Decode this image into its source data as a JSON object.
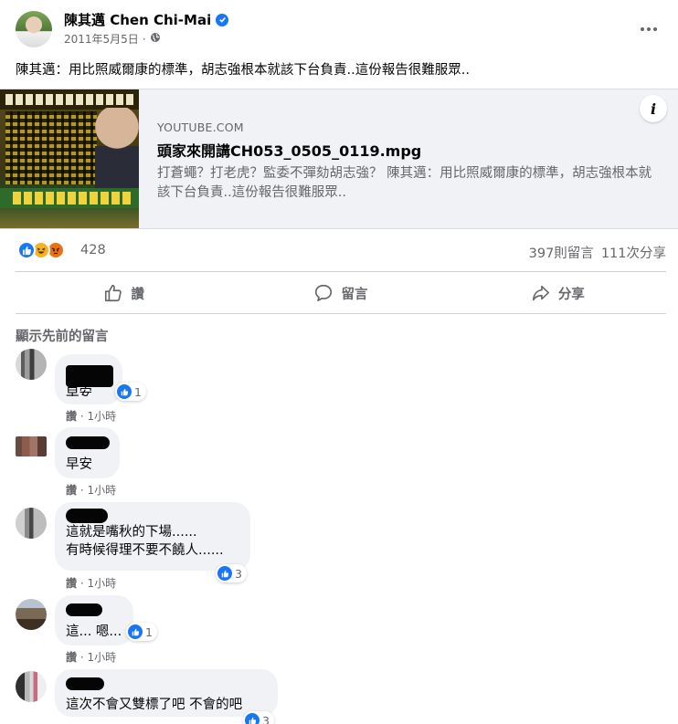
{
  "post": {
    "author_name": "陳其邁 Chen Chi-Mai",
    "date": "2011年5月5日",
    "dot": "·",
    "text": "陳其邁：用比照威爾康的標準，胡志強根本就該下台負責..這份報告很難服眾.."
  },
  "link_card": {
    "domain": "YOUTUBE.COM",
    "title": "頭家來開講CH053_0505_0119.mpg",
    "description": "打蒼蠅？打老虎？監委不彈劾胡志強？ 陳其邁：用比照威爾康的標準，胡志強根本就該下台負責..這份報告很難服眾..",
    "info_icon": "i"
  },
  "reactions": {
    "types": [
      "like-icon",
      "haha-icon",
      "angry-icon"
    ],
    "count": "428",
    "comments": "397則留言",
    "shares": "111次分享"
  },
  "actions": {
    "like": "讚",
    "comment": "留言",
    "share": "分享"
  },
  "comments_section": {
    "previous_label": "顯示先前的留言",
    "items": [
      {
        "text": "早安",
        "likes": "1",
        "like_label": "讚",
        "time": "1小時"
      },
      {
        "text": "早安",
        "likes": "",
        "like_label": "讚",
        "time": "1小時"
      },
      {
        "text_line1": "這就是嘴秋的下場......",
        "text_line2": "有時候得理不要不饒人......",
        "likes": "3",
        "like_label": "讚",
        "time": "1小時"
      },
      {
        "text": "這... 嗯...",
        "likes": "1",
        "like_label": "讚",
        "time": "1小時"
      },
      {
        "text": "這次不會又雙標了吧 不會的吧",
        "likes": "3"
      }
    ],
    "meta_sep": " · "
  },
  "colors": {
    "accent": "#1877f2",
    "secondary_text": "#65676b",
    "bubble": "#f0f2f5"
  }
}
